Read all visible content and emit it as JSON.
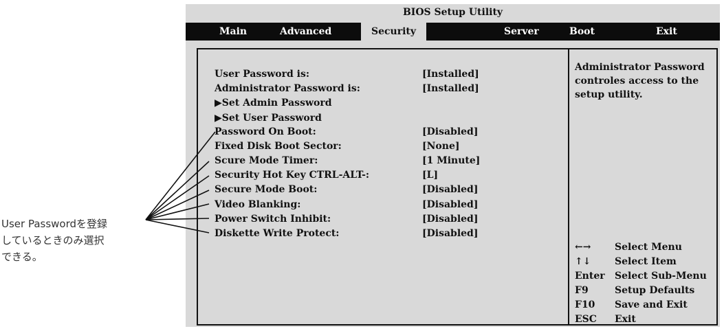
{
  "title": "BIOS Setup Utility",
  "menu": [
    "Main",
    "Advanced",
    "Security",
    "Server",
    "Boot",
    "Exit"
  ],
  "settings": [
    {
      "label": "User Password is:",
      "value": "[Installed]"
    },
    {
      "label": "Administrator Password is:",
      "value": "[Installed]"
    },
    {
      "label": "▶Set Admin Password",
      "value": ""
    },
    {
      "label": "▶Set User Password",
      "value": ""
    },
    {
      "label": "Password On Boot:",
      "value": "[Disabled]"
    },
    {
      "label": "Fixed Disk Boot Sector:",
      "value": "[None]"
    },
    {
      "label": "Scure Mode Timer:",
      "value": "[1 Minute]"
    },
    {
      "label": "Security Hot Key CTRL-ALT-:",
      "value": "[L]"
    },
    {
      "label": "Secure Mode Boot:",
      "value": "[Disabled]"
    },
    {
      "label": "Video Blanking:",
      "value": "[Disabled]"
    },
    {
      "label": "Power Switch Inhibit:",
      "value": "[Disabled]"
    },
    {
      "label": "Diskette Write Protect:",
      "value": "[Disabled]"
    }
  ],
  "help": {
    "line1": "Administrator Password",
    "line2": "controles access to the",
    "line3": "setup utility."
  },
  "keys": [
    {
      "key": "←→",
      "desc": "Select Menu"
    },
    {
      "key": "↑↓",
      "desc": "Select Item"
    },
    {
      "key": "Enter",
      "desc": "Select Sub-Menu"
    },
    {
      "key": "F9",
      "desc": "Setup Defaults"
    },
    {
      "key": "F10",
      "desc": "Save and Exit"
    },
    {
      "key": "ESC",
      "desc": "Exit"
    }
  ],
  "note": {
    "line1": "User Passwordを登録",
    "line2": "しているときのみ選択",
    "line3": "できる。"
  },
  "colors": {
    "screen": "#d9d9d9",
    "menubar": "#0c0c0c",
    "text": "#111111"
  }
}
